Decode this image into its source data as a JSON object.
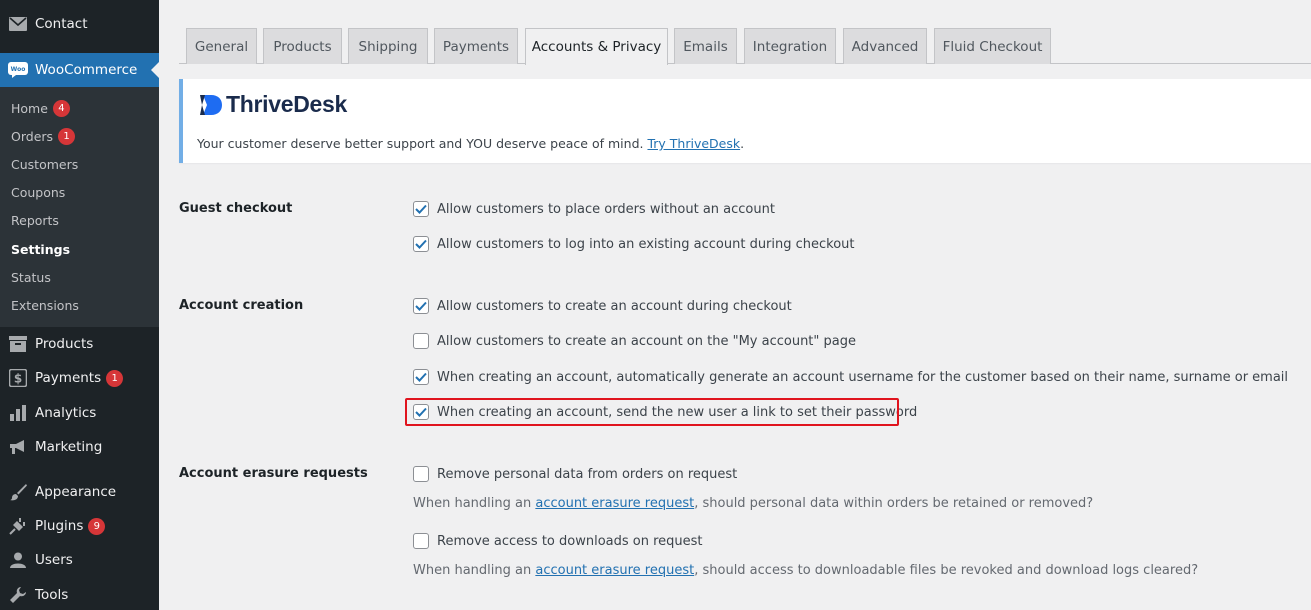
{
  "sidebar": {
    "contact": "Contact",
    "woocommerce": "WooCommerce",
    "submenu": [
      {
        "label": "Home",
        "badge": "4"
      },
      {
        "label": "Orders",
        "badge": "1"
      },
      {
        "label": "Customers"
      },
      {
        "label": "Coupons"
      },
      {
        "label": "Reports"
      },
      {
        "label": "Settings"
      },
      {
        "label": "Status"
      },
      {
        "label": "Extensions"
      }
    ],
    "products": "Products",
    "payments": "Payments",
    "payments_badge": "1",
    "analytics": "Analytics",
    "marketing": "Marketing",
    "appearance": "Appearance",
    "plugins": "Plugins",
    "plugins_badge": "9",
    "users": "Users",
    "tools": "Tools"
  },
  "tabs": [
    "General",
    "Products",
    "Shipping",
    "Payments",
    "Accounts & Privacy",
    "Emails",
    "Integration",
    "Advanced",
    "Fluid Checkout"
  ],
  "active_tab": "Accounts & Privacy",
  "banner": {
    "logo_text": "ThriveDesk",
    "text": "Your customer deserve better support and YOU deserve peace of mind.",
    "link": "Try ThriveDesk",
    "suffix": "."
  },
  "settings": {
    "guest_checkout": {
      "label": "Guest checkout",
      "options": [
        {
          "text": "Allow customers to place orders without an account",
          "checked": true
        },
        {
          "text": "Allow customers to log into an existing account during checkout",
          "checked": true
        }
      ]
    },
    "account_creation": {
      "label": "Account creation",
      "options": [
        {
          "text": "Allow customers to create an account during checkout",
          "checked": true
        },
        {
          "text": "Allow customers to create an account on the \"My account\" page",
          "checked": false
        },
        {
          "text": "When creating an account, automatically generate an account username for the customer based on their name, surname or email",
          "checked": true
        },
        {
          "text": "When creating an account, send the new user a link to set their password",
          "checked": true
        }
      ]
    },
    "erasure": {
      "label": "Account erasure requests",
      "options": [
        {
          "text": "Remove personal data from orders on request",
          "checked": false
        },
        {
          "text": "Remove access to downloads on request",
          "checked": false
        }
      ],
      "desc1_pre": "When handling an",
      "desc1_link": "account erasure request",
      "desc1_post": ", should personal data within orders be retained or removed?",
      "desc2_pre": "When handling an",
      "desc2_link": "account erasure request",
      "desc2_post": ", should access to downloadable files be revoked and download logs cleared?"
    }
  },
  "colors": {
    "accent": "#2271b1",
    "highlight": "#e0141e",
    "badge": "#d63638"
  }
}
